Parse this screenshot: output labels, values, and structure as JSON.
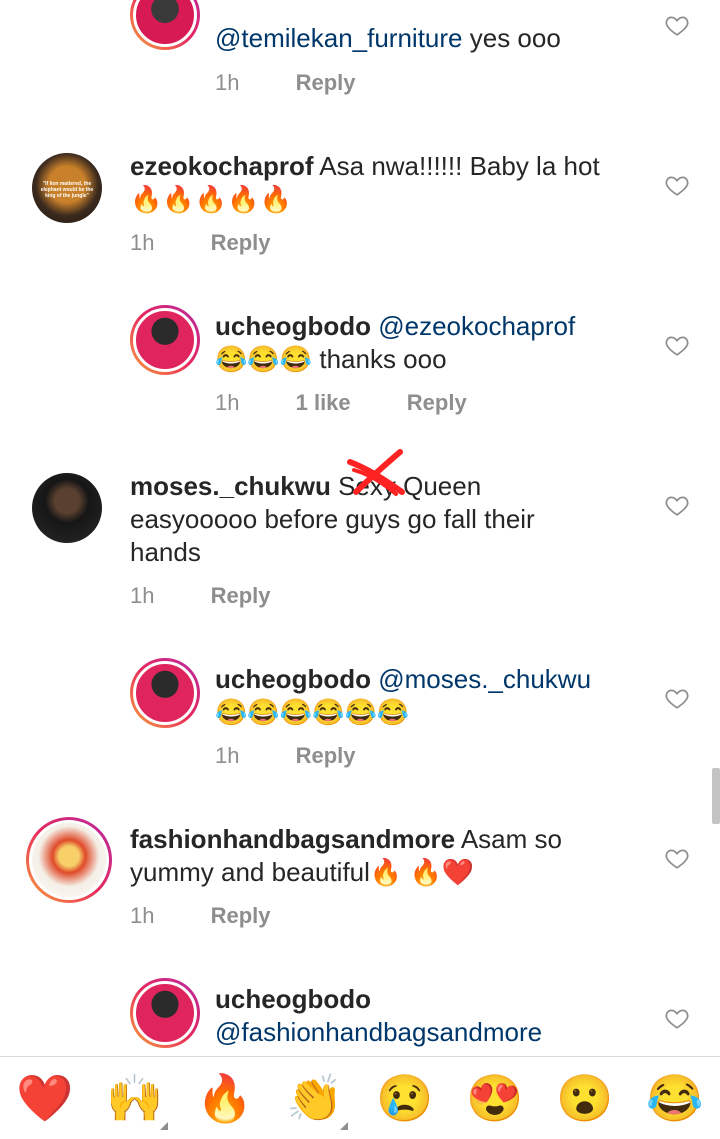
{
  "comments": [
    {
      "id": "c0",
      "type": "reply",
      "username": "",
      "mention": "@temilekan_furniture",
      "text": " yes ooo",
      "time": "1h",
      "likes": "",
      "reply": "Reply"
    },
    {
      "id": "c1",
      "type": "top",
      "username": "ezeokochaprof",
      "text": " Asa nwa!!!!!! Baby la hot",
      "line2": "🔥🔥🔥🔥🔥",
      "time": "1h",
      "reply": "Reply",
      "avatar_text": "\"If lion mattered, the elephant would be the king of the jungle\""
    },
    {
      "id": "c2",
      "type": "reply",
      "username": "ucheogbodo",
      "mention": "@ezeokochaprof",
      "line2": "😂😂😂 thanks ooo",
      "time": "1h",
      "likes": "1 like",
      "reply": "Reply"
    },
    {
      "id": "c3",
      "type": "top",
      "username": "moses._chukwu",
      "text": " Sexy Queen",
      "line2": "easyooooo before guys go fall their",
      "line3": "hands",
      "time": "1h",
      "reply": "Reply"
    },
    {
      "id": "c4",
      "type": "reply",
      "username": "ucheogbodo",
      "mention": "@moses._chukwu",
      "line2": "😂😂😂😂😂😂",
      "time": "1h",
      "reply": "Reply"
    },
    {
      "id": "c5",
      "type": "top",
      "username": "fashionhandbagsandmore",
      "text": " Asam so",
      "line2": "yummy and beautiful🔥 🔥❤️",
      "time": "1h",
      "reply": "Reply"
    },
    {
      "id": "c6",
      "type": "reply",
      "username": "ucheogbodo",
      "mention": "@fashionhandbagsandmore"
    }
  ],
  "emoji_bar": [
    "❤️",
    "🙌",
    "🔥",
    "👏",
    "😢",
    "😍",
    "😮",
    "😂"
  ],
  "colors": {
    "mention": "#00376b",
    "meta": "#8e8e8e",
    "text": "#262626"
  }
}
